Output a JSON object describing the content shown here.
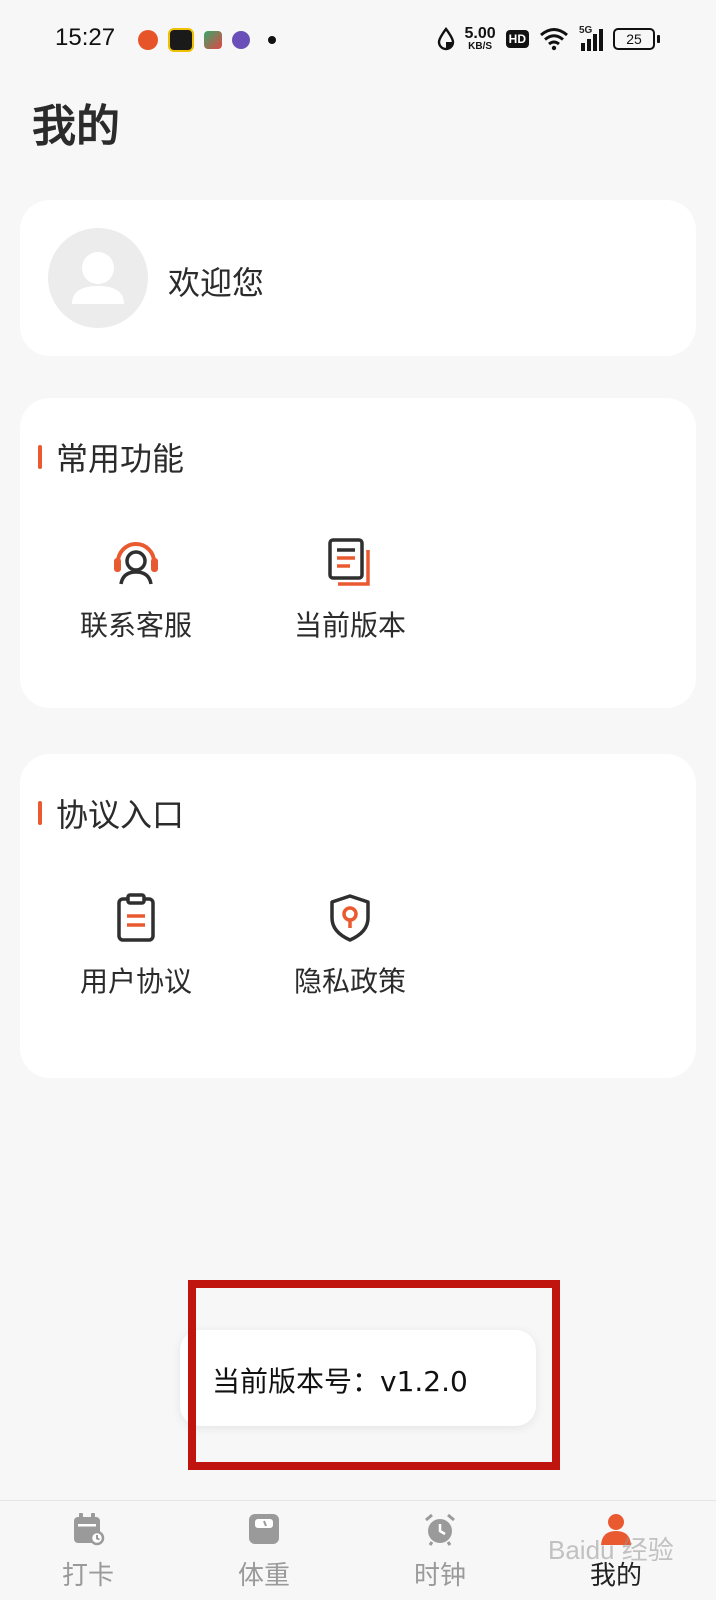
{
  "status_bar": {
    "time": "15:27",
    "net_speed_value": "5.00",
    "net_speed_unit": "KB/S",
    "hd": "HD",
    "network": "5G",
    "battery": "25"
  },
  "header": {
    "title": "我的"
  },
  "profile": {
    "welcome": "欢迎您"
  },
  "sections": [
    {
      "title": "常用功能",
      "items": [
        {
          "label": "联系客服",
          "icon": "headset-icon"
        },
        {
          "label": "当前版本",
          "icon": "document-stack-icon"
        }
      ]
    },
    {
      "title": "协议入口",
      "items": [
        {
          "label": "用户协议",
          "icon": "clipboard-icon"
        },
        {
          "label": "隐私政策",
          "icon": "shield-icon"
        }
      ]
    }
  ],
  "toast": {
    "text": "当前版本号：v1.2.0"
  },
  "bottom_nav": {
    "items": [
      {
        "label": "打卡",
        "icon": "calendar-check-icon",
        "active": false
      },
      {
        "label": "体重",
        "icon": "scale-icon",
        "active": false
      },
      {
        "label": "时钟",
        "icon": "alarm-clock-icon",
        "active": false
      },
      {
        "label": "我的",
        "icon": "user-icon",
        "active": true
      }
    ]
  },
  "watermark": "Baidu 经验",
  "colors": {
    "accent": "#ea5a31",
    "icon_dark": "#2f2f2f",
    "highlight_border": "#c0150f",
    "background": "#f7f7f7",
    "card": "#ffffff",
    "nav_inactive": "#9a9a9a"
  }
}
